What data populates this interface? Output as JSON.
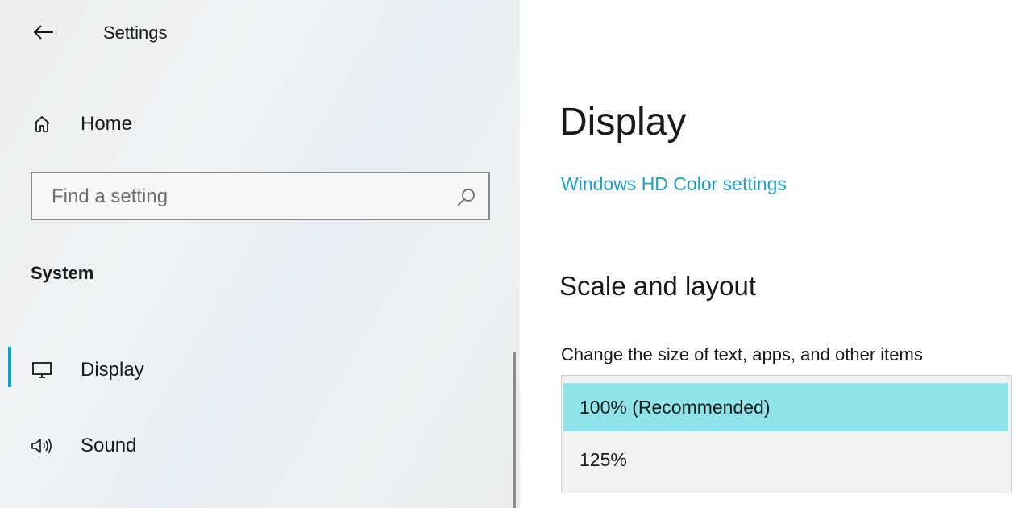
{
  "window": {
    "title": "Settings"
  },
  "sidebar": {
    "home_label": "Home",
    "search": {
      "placeholder": "Find a setting",
      "value": ""
    },
    "section_label": "System",
    "items": [
      {
        "label": "Display",
        "icon": "monitor-icon",
        "active": true
      },
      {
        "label": "Sound",
        "icon": "speaker-icon",
        "active": false
      }
    ]
  },
  "main": {
    "title": "Display",
    "hd_color_link": "Windows HD Color settings",
    "scale_section": {
      "heading": "Scale and layout",
      "field_label": "Change the size of text, apps, and other items",
      "options": [
        "100% (Recommended)",
        "125%"
      ],
      "selected": "100% (Recommended)"
    }
  },
  "colors": {
    "accent": "#00a8c6",
    "link": "#1aa1c8",
    "selected_option": "#8fe4ea"
  }
}
